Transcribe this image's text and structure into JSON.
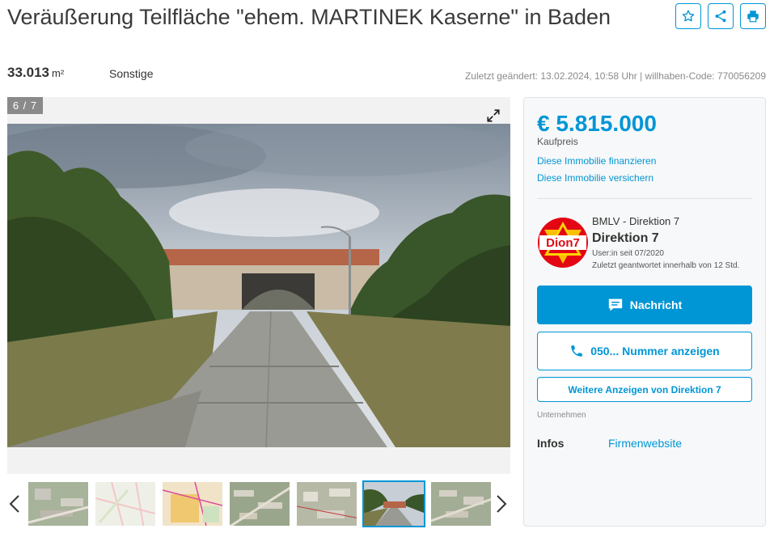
{
  "listing": {
    "title": "Veräußerung Teilfläche \"ehem. MARTINEK Kaserne\" in Baden",
    "area_value": "33.013",
    "area_unit": "m²",
    "category": "Sonstige",
    "meta": "Zuletzt geändert: 13.02.2024, 10:58 Uhr | willhaben-Code: 770056209"
  },
  "actions": {
    "favorite_icon": "star-icon",
    "share_icon": "share-icon",
    "print_icon": "printer-icon"
  },
  "gallery": {
    "counter": "6 / 7",
    "expand_icon": "expand-icon",
    "photo_subject": "Kaserne gate with road",
    "thumbnails": [
      {
        "kind": "aerial"
      },
      {
        "kind": "map"
      },
      {
        "kind": "plan"
      },
      {
        "kind": "aerial"
      },
      {
        "kind": "aerial"
      },
      {
        "kind": "photo",
        "active": true
      },
      {
        "kind": "aerial"
      }
    ]
  },
  "sidebar": {
    "price": "€ 5.815.000",
    "price_label": "Kaufpreis",
    "finance_link": "Diese Immobilie finanzieren",
    "insure_link": "Diese Immobilie versichern",
    "seller": {
      "logo_text": "Dion7",
      "org": "BMLV - Direktion 7",
      "name": "Direktion 7",
      "since": "User:in seit 07/2020",
      "reply": "Zuletzt geantwortet innerhalb von 12 Std."
    },
    "message_button": "Nachricht",
    "call_button": "050... Nummer anzeigen",
    "more_button": "Weitere Anzeigen von Direktion 7",
    "company_label": "Unternehmen",
    "infos_label": "Infos",
    "infos_link": "Firmenwebsite"
  },
  "colors": {
    "accent": "#0096d6",
    "panel_bg": "#f7f8f9",
    "logo_red": "#e30613",
    "logo_yellow": "#ffd400"
  }
}
